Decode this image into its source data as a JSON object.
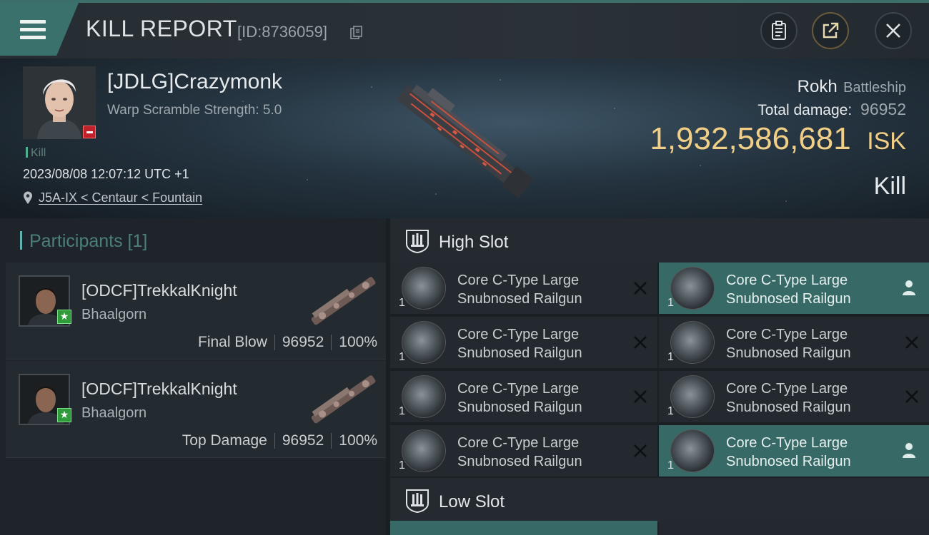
{
  "header": {
    "title": "KILL REPORT",
    "report_id": "[ID:8736059]"
  },
  "victim": {
    "name": "[JDLG]Crazymonk",
    "warp_scramble": "Warp Scramble Strength: 5.0",
    "kill_tag": "Kill",
    "datetime": "2023/08/08 12:07:12 UTC +1",
    "location": "J5A-IX < Centaur < Fountain",
    "ship_name": "Rokh",
    "ship_class": "Battleship",
    "total_damage_label": "Total damage:",
    "total_damage": "96952",
    "isk_amount": "1,932,586,681",
    "isk_currency": "ISK",
    "result": "Kill"
  },
  "participants": {
    "title": "Participants [1]",
    "rows": [
      {
        "name": "[ODCF]TrekkalKnight",
        "ship": "Bhaalgorn",
        "role": "Final Blow",
        "damage": "96952",
        "percent": "100%"
      },
      {
        "name": "[ODCF]TrekkalKnight",
        "ship": "Bhaalgorn",
        "role": "Top Damage",
        "damage": "96952",
        "percent": "100%"
      }
    ]
  },
  "fitting": {
    "high_slot_title": "High Slot",
    "low_slot_title": "Low Slot",
    "modules": [
      {
        "line1": "Core C-Type Large",
        "line2": "Snubnosed Railgun",
        "qty": "1",
        "state": "destroyed"
      },
      {
        "line1": "Core C-Type Large",
        "line2": "Snubnosed Railgun",
        "qty": "1",
        "state": "dropped"
      },
      {
        "line1": "Core C-Type Large",
        "line2": "Snubnosed Railgun",
        "qty": "1",
        "state": "destroyed"
      },
      {
        "line1": "Core C-Type Large",
        "line2": "Snubnosed Railgun",
        "qty": "1",
        "state": "destroyed"
      },
      {
        "line1": "Core C-Type Large",
        "line2": "Snubnosed Railgun",
        "qty": "1",
        "state": "destroyed"
      },
      {
        "line1": "Core C-Type Large",
        "line2": "Snubnosed Railgun",
        "qty": "1",
        "state": "destroyed"
      },
      {
        "line1": "Core C-Type Large",
        "line2": "Snubnosed Railgun",
        "qty": "1",
        "state": "destroyed"
      },
      {
        "line1": "Core C-Type Large",
        "line2": "Snubnosed Railgun",
        "qty": "1",
        "state": "dropped"
      }
    ]
  },
  "colors": {
    "accent": "#3a716c",
    "isk": "#f1cf86",
    "highlight_row": "#376a66"
  },
  "icons": [
    "menu-icon",
    "copy-icon",
    "clipboard-icon",
    "share-icon",
    "close-icon",
    "location-pin-icon",
    "high-slot-icon",
    "low-slot-icon",
    "destroyed-x-icon",
    "dropped-person-icon"
  ]
}
